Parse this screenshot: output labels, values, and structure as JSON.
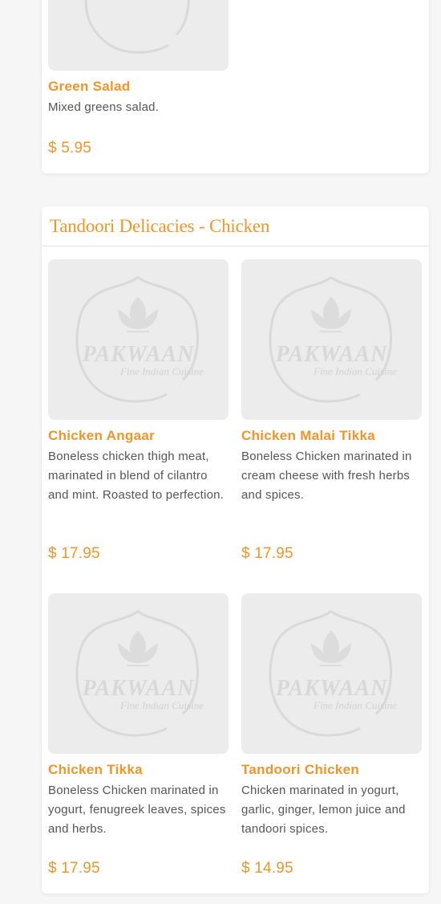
{
  "logo": {
    "name": "PAKWAAN",
    "tagline": "Fine Indian Cuisine"
  },
  "previous_section": {
    "items": [
      {
        "name": "Green Salad",
        "description": "Mixed greens salad.",
        "price": "$ 5.95"
      }
    ]
  },
  "chicken_section": {
    "title": "Tandoori Delicacies - Chicken",
    "items": [
      {
        "name": "Chicken Angaar",
        "description": "Boneless chicken thigh meat, marinated in blend of cilantro and mint. Roasted to perfection.",
        "price": "$ 17.95"
      },
      {
        "name": "Chicken Malai Tikka",
        "description": "Boneless Chicken marinated in cream cheese with fresh herbs and spices.",
        "price": "$ 17.95"
      },
      {
        "name": "Chicken Tikka",
        "description": "Boneless Chicken marinated in yogurt, fenugreek leaves, spices and herbs.",
        "price": "$ 17.95"
      },
      {
        "name": "Tandoori Chicken",
        "description": "Chicken marinated in yogurt, garlic, ginger, lemon juice and tandoori spices.",
        "price": "$ 14.95"
      }
    ]
  },
  "colors": {
    "accent": "#f0952a",
    "text": "#555555",
    "placeholder_bg": "#ececec"
  }
}
